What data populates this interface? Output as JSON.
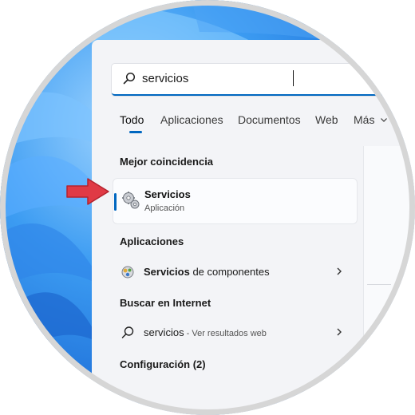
{
  "search": {
    "value": "servicios"
  },
  "tabs": [
    {
      "label": "Todo",
      "active": true
    },
    {
      "label": "Aplicaciones"
    },
    {
      "label": "Documentos"
    },
    {
      "label": "Web"
    },
    {
      "label": "Más"
    }
  ],
  "sections": {
    "best_match": "Mejor coincidencia",
    "apps": "Aplicaciones",
    "internet": "Buscar en Internet",
    "settings": "Configuración (2)"
  },
  "best_match": {
    "title": "Servicios",
    "subtitle": "Aplicación",
    "icon": "gears-icon"
  },
  "apps": [
    {
      "bold": "Servicios",
      "rest": " de componentes",
      "icon": "component-services-icon"
    }
  ],
  "internet": [
    {
      "term": "servicios",
      "suffix": " - Ver resultados web",
      "icon": "search-icon"
    }
  ],
  "colors": {
    "accent": "#0067c0",
    "arrow": "#e03a45",
    "panel": "#f3f4f7"
  }
}
